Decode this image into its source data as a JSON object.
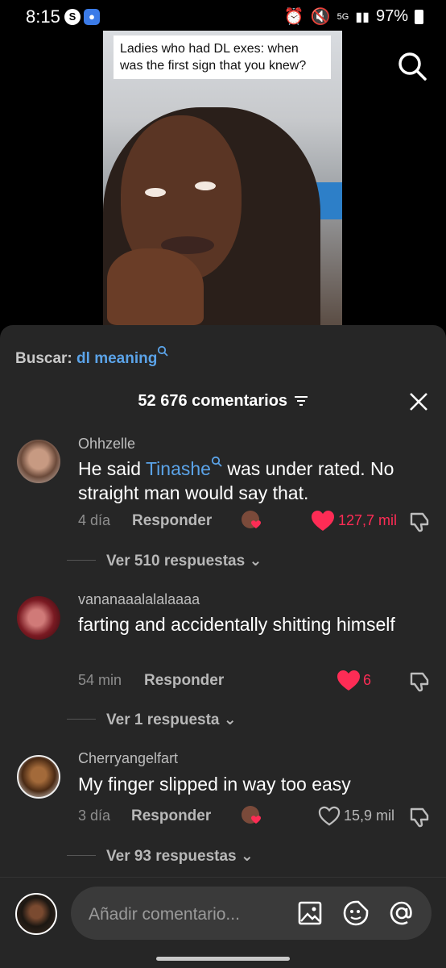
{
  "status": {
    "time": "8:15",
    "network": "5G",
    "battery": "97%"
  },
  "video": {
    "caption": "Ladies who had DL exes: when was the first sign that you knew?"
  },
  "search": {
    "prefix": "Buscar:",
    "term": "dl meaning"
  },
  "header": {
    "count": "52 676 comentarios"
  },
  "comments": [
    {
      "user": "Ohhzelle",
      "text_before": "He said ",
      "link": "Tinashe",
      "text_after": " was under rated. No straight man would say that.",
      "age": "4 día",
      "reply": "Responder",
      "likes": "127,7 mil",
      "liked": true,
      "view_replies": "Ver 510 respuestas"
    },
    {
      "user": "vananaaalalalaaaa",
      "text": "farting and accidentally shitting himself",
      "age": "54 min",
      "reply": "Responder",
      "likes": "6",
      "liked": true,
      "view_replies": "Ver 1 respuesta"
    },
    {
      "user": "Cherryangelfart",
      "text": "My finger slipped in way too easy",
      "age": "3 día",
      "reply": "Responder",
      "likes": "15,9 mil",
      "liked": false,
      "view_replies": "Ver 93 respuestas"
    }
  ],
  "composer": {
    "placeholder": "Añadir comentario..."
  },
  "colors": {
    "accent_link": "#5ba3e8",
    "like_red": "#fe2c55",
    "sheet_bg": "#262626"
  }
}
